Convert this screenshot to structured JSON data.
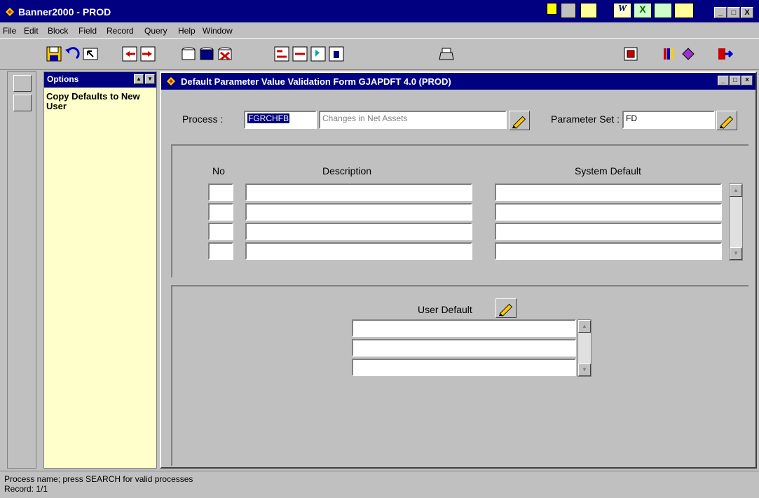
{
  "window": {
    "title": "Banner2000 - PROD",
    "controls": [
      "_",
      "□",
      "X"
    ]
  },
  "menu": [
    "File",
    "Edit",
    "Block",
    "Field",
    "Record",
    "Query",
    "Help",
    "Window"
  ],
  "options_panel": {
    "title": "Options",
    "item": "Copy Defaults to New User"
  },
  "form": {
    "title": "Default Parameter Value Validation Form  GJAPDFT  4.0  (PROD)",
    "process_label": "Process :",
    "process_code": "FGRCHFB",
    "process_desc": "Changes in Net Assets",
    "param_set_label": "Parameter Set :",
    "param_set_value": "FD",
    "grid_headers": {
      "no": "No",
      "description": "Description",
      "system_default": "System Default"
    },
    "grid_rows": [
      {
        "no": "",
        "description": "",
        "system_default": ""
      },
      {
        "no": "",
        "description": "",
        "system_default": ""
      },
      {
        "no": "",
        "description": "",
        "system_default": ""
      },
      {
        "no": "",
        "description": "",
        "system_default": ""
      }
    ],
    "user_default_label": "User Default",
    "user_default_rows": [
      "",
      "",
      ""
    ]
  },
  "status": {
    "message": "Process name; press SEARCH for valid processes",
    "record": "Record: 1/1"
  },
  "colors": {
    "titlebar": "#000080",
    "options_bg": "#ffffcc",
    "chrome": "#c0c0c0"
  }
}
